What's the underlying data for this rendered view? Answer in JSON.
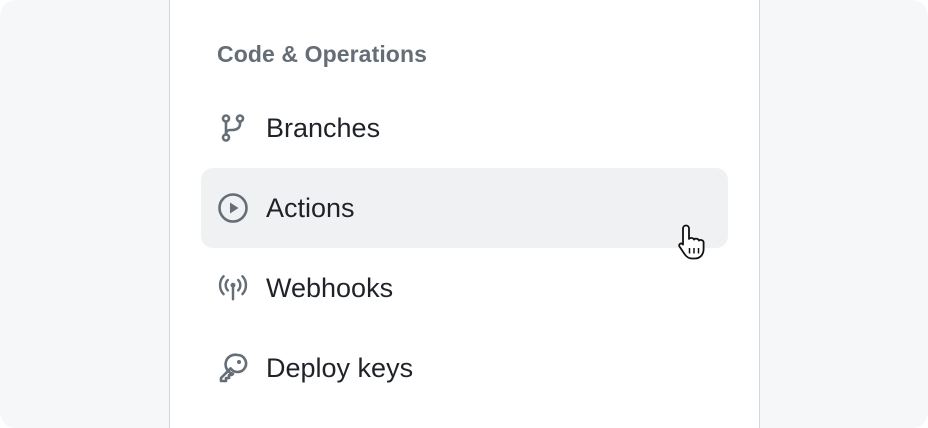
{
  "section": {
    "heading": "Code & Operations"
  },
  "nav": {
    "items": [
      {
        "label": "Branches",
        "icon": "git-branch-icon"
      },
      {
        "label": "Actions",
        "icon": "play-circle-icon",
        "hovered": true
      },
      {
        "label": "Webhooks",
        "icon": "broadcast-icon"
      },
      {
        "label": "Deploy keys",
        "icon": "key-icon"
      }
    ]
  },
  "colors": {
    "text": "#1f2328",
    "muted": "#656d76",
    "hover_bg": "#f0f1f3",
    "border": "#d0d7de",
    "outer_bg": "#f6f7f9"
  }
}
